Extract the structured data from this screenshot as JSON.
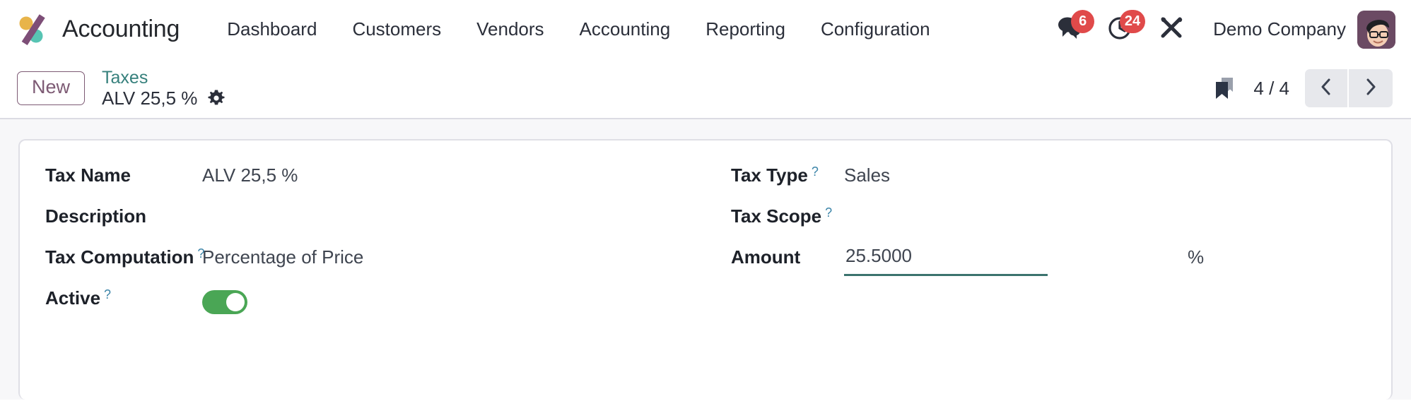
{
  "navbar": {
    "brand": "Accounting",
    "logo_icon": "odoo-logo-icon",
    "menu": [
      {
        "label": "Dashboard",
        "name": "nav-item-dashboard"
      },
      {
        "label": "Customers",
        "name": "nav-item-customers"
      },
      {
        "label": "Vendors",
        "name": "nav-item-vendors"
      },
      {
        "label": "Accounting",
        "name": "nav-item-accounting"
      },
      {
        "label": "Reporting",
        "name": "nav-item-reporting"
      },
      {
        "label": "Configuration",
        "name": "nav-item-configuration"
      }
    ],
    "messages": {
      "icon": "messages-icon",
      "badge": "6"
    },
    "activities": {
      "icon": "clock-activities-icon",
      "badge": "24"
    },
    "tools": {
      "icon": "tools-icon"
    },
    "company": "Demo Company",
    "avatar_icon": "user-avatar"
  },
  "control_panel": {
    "new_button": "New",
    "breadcrumb_parent": "Taxes",
    "breadcrumb_current": "ALV 25,5 %",
    "gear_icon": "gear-icon",
    "bookmark_icon": "bookmark-icon",
    "pager": "4 / 4",
    "prev_icon": "chevron-left-icon",
    "next_icon": "chevron-right-icon"
  },
  "form": {
    "left": [
      {
        "label": "Tax Name",
        "help": false,
        "value": "ALV 25,5 %",
        "name": "tax-name"
      },
      {
        "label": "Description",
        "help": false,
        "value": "",
        "name": "description"
      },
      {
        "label": "Tax Computation",
        "help": true,
        "value": "Percentage of Price",
        "name": "tax-computation"
      },
      {
        "label": "Active",
        "help": true,
        "value": "",
        "name": "active"
      }
    ],
    "right": [
      {
        "label": "Tax Type",
        "help": true,
        "value": "Sales",
        "name": "tax-type"
      },
      {
        "label": "Tax Scope",
        "help": true,
        "value": "",
        "name": "tax-scope"
      },
      {
        "label": "Amount",
        "help": false,
        "value": "25.5000",
        "name": "amount"
      }
    ],
    "help_marker": "?",
    "amount_value": "25.5000",
    "amount_suffix": "%",
    "active_on": true
  },
  "colors": {
    "brand_purple": "#7d5a74",
    "brand_teal": "#36807c",
    "badge_red": "#e04a4a",
    "toggle_green": "#4aa655",
    "focus_underline": "#3b736e",
    "help_blue": "#3b84a8"
  }
}
